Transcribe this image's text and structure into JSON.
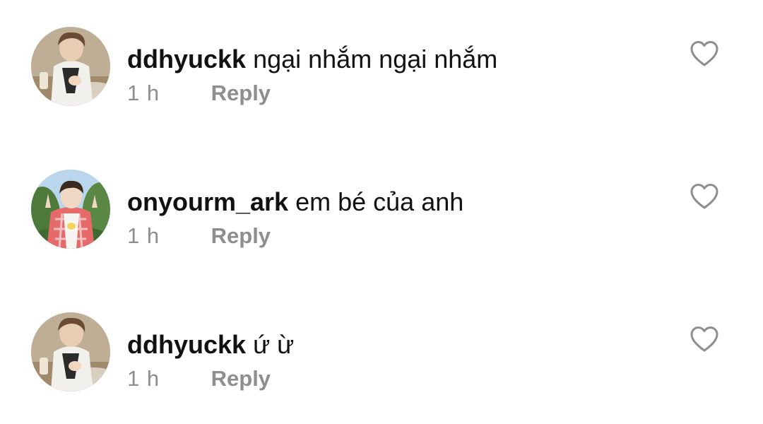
{
  "comments": [
    {
      "username": "ddhyuckk",
      "text": "ngại nhắm ngại nhắm",
      "time": "1 h",
      "reply_label": "Reply",
      "avatar_icon": "profile-photo-person-seated-table",
      "like_icon": "heart-outline-icon"
    },
    {
      "username": "onyourm_ark",
      "text": "em bé của anh",
      "time": "1 h",
      "reply_label": "Reply",
      "avatar_icon": "profile-photo-person-plaid-shirt-outdoors",
      "like_icon": "heart-outline-icon"
    },
    {
      "username": "ddhyuckk",
      "text": "ứ ừ",
      "time": "1 h",
      "reply_label": "Reply",
      "avatar_icon": "profile-photo-person-seated-table",
      "like_icon": "heart-outline-icon"
    }
  ],
  "colors": {
    "text": "#111111",
    "meta": "#8e8e8e",
    "heart_outline": "#8e8e8e",
    "background": "#ffffff"
  }
}
